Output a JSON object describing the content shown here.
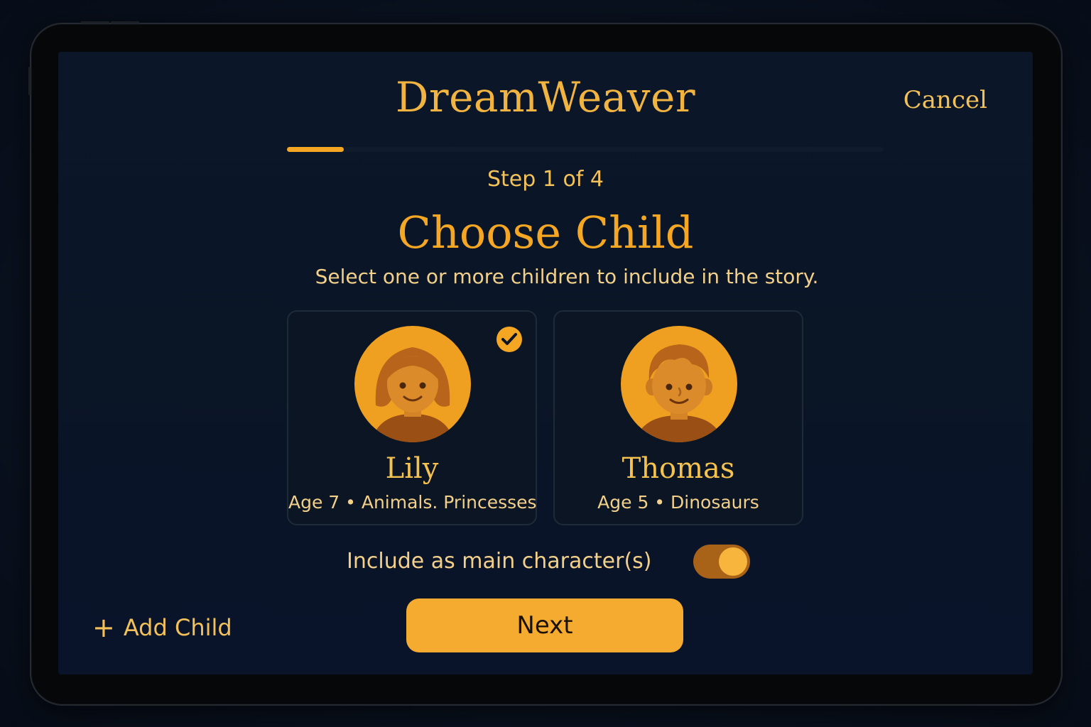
{
  "app": {
    "title": "DreamWeaver",
    "cancel_label": "Cancel"
  },
  "progress": {
    "step_text": "Step 1 of 4",
    "fraction": 0.095
  },
  "page": {
    "heading": "Choose Child",
    "subtitle": "Select one or more children to include in the story."
  },
  "children": [
    {
      "name": "Lily",
      "meta": "Age 7 • Animals. Princesses",
      "selected": true,
      "avatar_icon": "girl-avatar-icon"
    },
    {
      "name": "Thomas",
      "meta": "Age 5 • Dinosaurs",
      "selected": false,
      "avatar_icon": "boy-avatar-icon"
    }
  ],
  "main_character": {
    "label": "Include as main character(s)",
    "enabled": true
  },
  "actions": {
    "add_child_label": "Add Child",
    "add_icon": "plus-icon",
    "next_label": "Next"
  },
  "colors": {
    "accent": "#f5a623",
    "text_soft": "#f2d08a",
    "background": "#0a1526",
    "toggle_track": "#a86318"
  }
}
